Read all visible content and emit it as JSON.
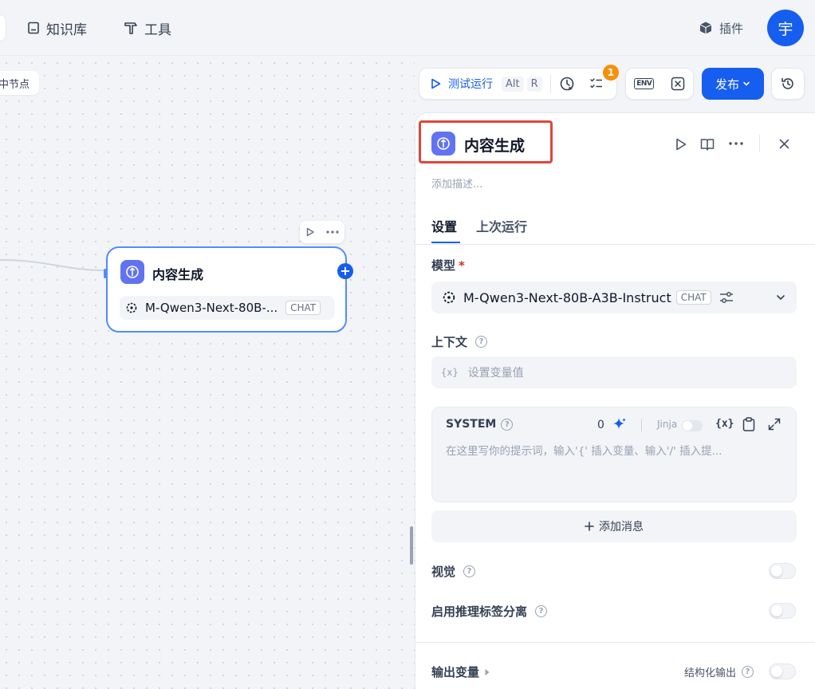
{
  "topnav": {
    "knowledge_label": "知识库",
    "tools_label": "工具",
    "plugins_label": "插件",
    "avatar_text": "宇"
  },
  "canvas": {
    "node_pill_label": "中节点",
    "node": {
      "title": "内容生成",
      "model": "M-Qwen3-Next-80B-...",
      "model_tag": "CHAT"
    }
  },
  "toolbar": {
    "test_run_label": "测试运行",
    "shortcut_keys": [
      "Alt",
      "R"
    ],
    "checklist_badge": "1",
    "env_label": "ENV",
    "publish_label": "发布"
  },
  "panel": {
    "title": "内容生成",
    "description_placeholder": "添加描述...",
    "tabs": [
      {
        "label": "设置",
        "active": true
      },
      {
        "label": "上次运行",
        "active": false
      }
    ],
    "model_label": "模型",
    "required_mark": "*",
    "model_name": "M-Qwen3-Next-80B-A3B-Instruct",
    "model_tag": "CHAT",
    "context_label": "上下文",
    "context_placeholder": "设置变量值",
    "var_icon_text": "{x}",
    "system": {
      "role_label": "SYSTEM",
      "token_count": "0",
      "jinja_label": "Jinja",
      "var_icon_text": "{x}",
      "placeholder": "在这里写你的提示词，输入'{' 插入变量、输入'/' 插入提..."
    },
    "add_message_label": "添加消息",
    "vision_label": "视觉",
    "reasoning_label": "启用推理标签分离",
    "output_vars_label": "输出变量",
    "structured_output_label": "结构化输出"
  },
  "colors": {
    "accent": "#155eef",
    "node_icon": "#6172f3",
    "highlight": "#e0453a",
    "badge": "#f79009"
  }
}
